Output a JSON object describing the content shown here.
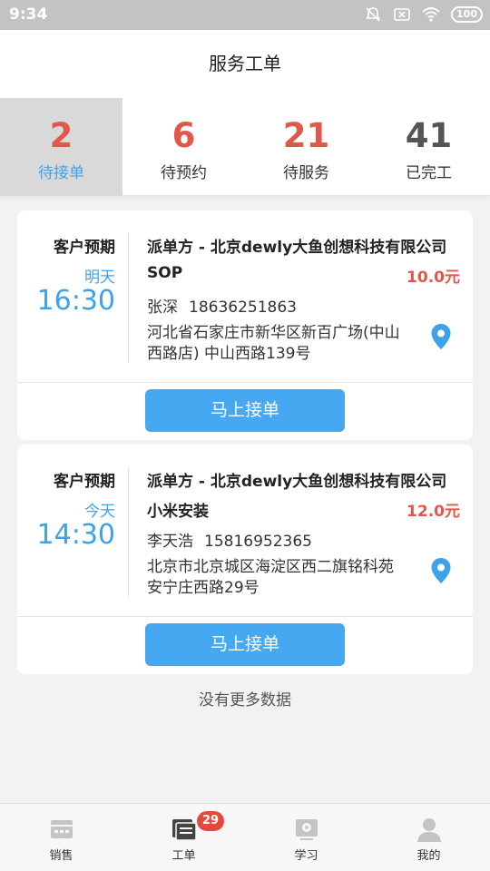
{
  "status_bar": {
    "time": "9:34",
    "battery": "100"
  },
  "header": {
    "title": "服务工单"
  },
  "tabs": [
    {
      "count": "2",
      "label": "待接单"
    },
    {
      "count": "6",
      "label": "待预约"
    },
    {
      "count": "21",
      "label": "待服务"
    },
    {
      "count": "41",
      "label": "已完工"
    }
  ],
  "orders": [
    {
      "expect_label": "客户预期",
      "day": "明天",
      "time": "16:30",
      "dispatcher": "派单方 - 北京dewly大鱼创想科技有限公司",
      "service": "SOP",
      "price": "10.0元",
      "contact_name": "张深",
      "contact_phone": "18636251863",
      "address": "河北省石家庄市新华区新百广场(中山西路店) 中山西路139号",
      "accept_label": "马上接单"
    },
    {
      "expect_label": "客户预期",
      "day": "今天",
      "time": "14:30",
      "dispatcher": "派单方 - 北京dewly大鱼创想科技有限公司",
      "service": "小米安装",
      "price": "12.0元",
      "contact_name": "李天浩",
      "contact_phone": "15816952365",
      "address": "北京市北京城区海淀区西二旗铭科苑 安宁庄西路29号",
      "accept_label": "马上接单"
    }
  ],
  "no_more_text": "没有更多数据",
  "bottom_nav": [
    {
      "label": "销售",
      "icon": "sales-icon"
    },
    {
      "label": "工单",
      "icon": "workorder-icon",
      "badge": "29"
    },
    {
      "label": "学习",
      "icon": "learning-icon"
    },
    {
      "label": "我的",
      "icon": "profile-icon"
    }
  ],
  "colors": {
    "accent_blue": "#46a8f0",
    "count_red": "#e0584a",
    "badge_red": "#e34a3c"
  }
}
